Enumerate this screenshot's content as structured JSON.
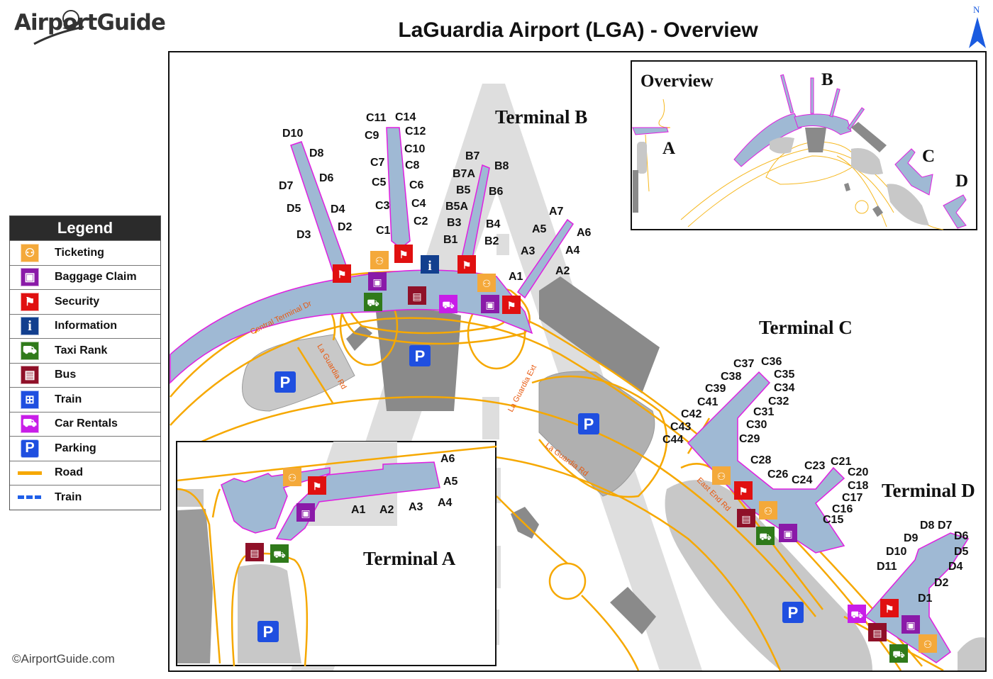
{
  "header": {
    "logo_text": "AirportGuide",
    "title": "LaGuardia Airport (LGA) - Overview",
    "north_label": "N"
  },
  "legend": {
    "title": "Legend",
    "items": [
      {
        "label": "Ticketing",
        "icon": "ticketing-icon",
        "color": "#f4a93a"
      },
      {
        "label": "Baggage Claim",
        "icon": "baggage-claim-icon",
        "color": "#8a1aa8"
      },
      {
        "label": "Security",
        "icon": "security-icon",
        "color": "#e01010"
      },
      {
        "label": "Information",
        "icon": "information-icon",
        "color": "#123f8e"
      },
      {
        "label": "Taxi Rank",
        "icon": "taxi-icon",
        "color": "#2f7a1a"
      },
      {
        "label": "Bus",
        "icon": "bus-icon",
        "color": "#8f1028"
      },
      {
        "label": "Train",
        "icon": "train-icon",
        "color": "#1f4fe0"
      },
      {
        "label": "Car Rentals",
        "icon": "car-rental-icon",
        "color": "#c81ee8"
      },
      {
        "label": "Parking",
        "icon": "parking-icon",
        "color": "#1f4fe0"
      },
      {
        "label": "Road",
        "icon": "road-line",
        "color": "#f6a800"
      },
      {
        "label": "Train",
        "icon": "train-line",
        "color": "#1f5fe8"
      }
    ]
  },
  "colors": {
    "terminal_fill": "#9fb9d4",
    "terminal_outline": "#e01ee0",
    "road": "#f6a800",
    "parking_area": "#c8c8c8",
    "building": "#8a8a8a",
    "runway_shade": "#dddddd"
  },
  "terminals": {
    "terminal_b": {
      "label": "Terminal B",
      "gates_d": [
        "D10",
        "D8",
        "D6",
        "D7",
        "D5",
        "D4",
        "D2",
        "D3"
      ],
      "gates_c": [
        "C11",
        "C14",
        "C9",
        "C12",
        "C10",
        "C7",
        "C8",
        "C5",
        "C6",
        "C3",
        "C4",
        "C2",
        "C1"
      ],
      "gates_b": [
        "B7",
        "B8",
        "B7A",
        "B5",
        "B6",
        "B5A",
        "B3",
        "B4",
        "B1",
        "B2"
      ],
      "gates_a": [
        "A7",
        "A5",
        "A6",
        "A3",
        "A4",
        "A2",
        "A1"
      ]
    },
    "terminal_c": {
      "label": "Terminal C",
      "gates": [
        "C37",
        "C36",
        "C38",
        "C35",
        "C39",
        "C34",
        "C41",
        "C32",
        "C42",
        "C31",
        "C43",
        "C30",
        "C44",
        "C29",
        "C28",
        "C26",
        "C24",
        "C23",
        "C21",
        "C20",
        "C18",
        "C17",
        "C16",
        "C15"
      ]
    },
    "terminal_d": {
      "label": "Terminal D",
      "gates": [
        "D8",
        "D7",
        "D9",
        "D6",
        "D10",
        "D5",
        "D11",
        "D4",
        "D2",
        "D1"
      ]
    },
    "terminal_a": {
      "label": "Terminal A",
      "gates": [
        "A6",
        "A5",
        "A1",
        "A2",
        "A3",
        "A4"
      ]
    }
  },
  "roads": {
    "central_terminal_dr": "Central Terminal Dr",
    "la_guardia_rd_1": "La Guardia Rd",
    "la_guardia_ext": "La Guardia Ext",
    "la_guardia_rd_2": "La Guardia Rd",
    "east_end_rd": "East End Rd"
  },
  "overview_inset": {
    "title": "Overview",
    "labels": [
      "A",
      "B",
      "C",
      "D"
    ]
  },
  "footer": {
    "copyright": "©AirportGuide.com"
  }
}
